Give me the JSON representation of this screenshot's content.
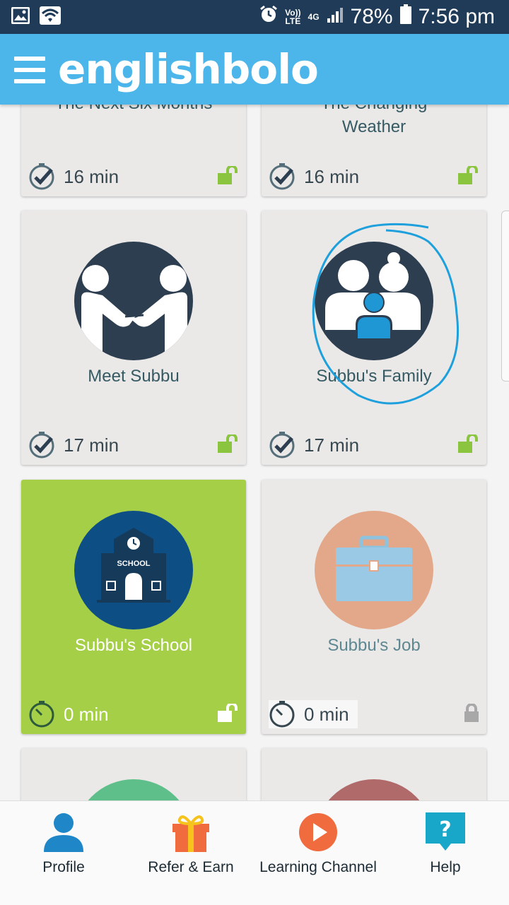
{
  "status_bar": {
    "volte": "Vo))",
    "lte": "LTE",
    "network": "4G",
    "battery": "78%",
    "time": "7:56 pm"
  },
  "app_bar": {
    "brand": "englishbolo"
  },
  "cards": [
    {
      "title": "The Next Six Months",
      "duration": "16 min",
      "status": "unlocked"
    },
    {
      "title": "The Changing Weather",
      "duration": "16 min",
      "status": "unlocked"
    },
    {
      "title": "Meet Subbu",
      "duration": "17 min",
      "status": "unlocked",
      "icon": "handshake-icon"
    },
    {
      "title": "Subbu's Family",
      "duration": "17 min",
      "status": "unlocked",
      "icon": "family-icon"
    },
    {
      "title": "Subbu's School",
      "duration": "0 min",
      "status": "unlocked",
      "icon": "school-icon",
      "school_sign": "SCHOOL"
    },
    {
      "title": "Subbu's Job",
      "duration": "0 min",
      "status": "locked",
      "icon": "briefcase-icon"
    }
  ],
  "bottom_nav": [
    {
      "label": "Profile",
      "icon": "profile-icon"
    },
    {
      "label": "Refer & Earn",
      "icon": "gift-icon"
    },
    {
      "label": "Learning Channel",
      "icon": "play-icon"
    },
    {
      "label": "Help",
      "icon": "help-icon"
    }
  ],
  "colors": {
    "status_bar": "#1f3b57",
    "app_bar": "#4cb6ea",
    "card": "#ebe9e8",
    "active_card": "#a6cf48",
    "icon_dark": "#2d3e50",
    "unlock_green": "#8bc53f",
    "annotation": "#1ea0dc"
  }
}
